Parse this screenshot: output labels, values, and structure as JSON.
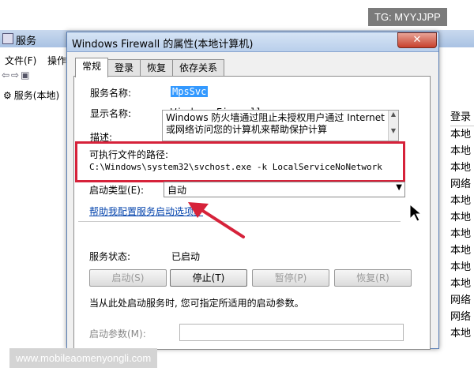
{
  "background_window": {
    "title": "服务",
    "menu": [
      "文件(F)",
      "操作"
    ],
    "toolbar_glyphs": "⇦⇨▣",
    "tree_item": "服务(本地)",
    "list_header": "登录",
    "list_items": [
      "本地",
      "本地",
      "本地",
      "网络",
      "本地",
      "本地",
      "本地",
      "本地",
      "本地",
      "本地",
      "网络",
      "网络",
      "本地"
    ]
  },
  "dialog": {
    "title": "Windows Firewall 的属性(本地计算机)",
    "close_glyph": "✕",
    "tabs": [
      {
        "label": "常规",
        "active": true
      },
      {
        "label": "登录",
        "active": false
      },
      {
        "label": "恢复",
        "active": false
      },
      {
        "label": "依存关系",
        "active": false
      }
    ],
    "service_name_label": "服务名称:",
    "service_name_value": "MpsSvc",
    "display_name_label": "显示名称:",
    "display_name_value": "Windows Firewall",
    "description_label": "描述:",
    "description_value": "Windows 防火墙通过阻止未授权用户通过 Internet 或网络访问您的计算机来帮助保护计算",
    "path_label": "可执行文件的路径:",
    "path_value": "C:\\Windows\\system32\\svchost.exe -k LocalServiceNoNetwork",
    "startup_type_label": "启动类型(E):",
    "startup_type_value": "自动",
    "help_link": "帮助我配置服务启动选项。",
    "service_status_label": "服务状态:",
    "service_status_value": "已启动",
    "buttons": {
      "start": "启动(S)",
      "stop": "停止(T)",
      "pause": "暂停(P)",
      "resume": "恢复(R)"
    },
    "hint_text": "当从此处启动服务时, 您可指定所适用的启动参数。",
    "start_params_label": "启动参数(M):"
  },
  "watermarks": {
    "top": "TG: MYYJJPP",
    "bottom": "www.mobileaomenyongli.com"
  },
  "colors": {
    "highlight_box": "#d6223a",
    "selection": "#3399ff",
    "link": "#0645ad"
  }
}
